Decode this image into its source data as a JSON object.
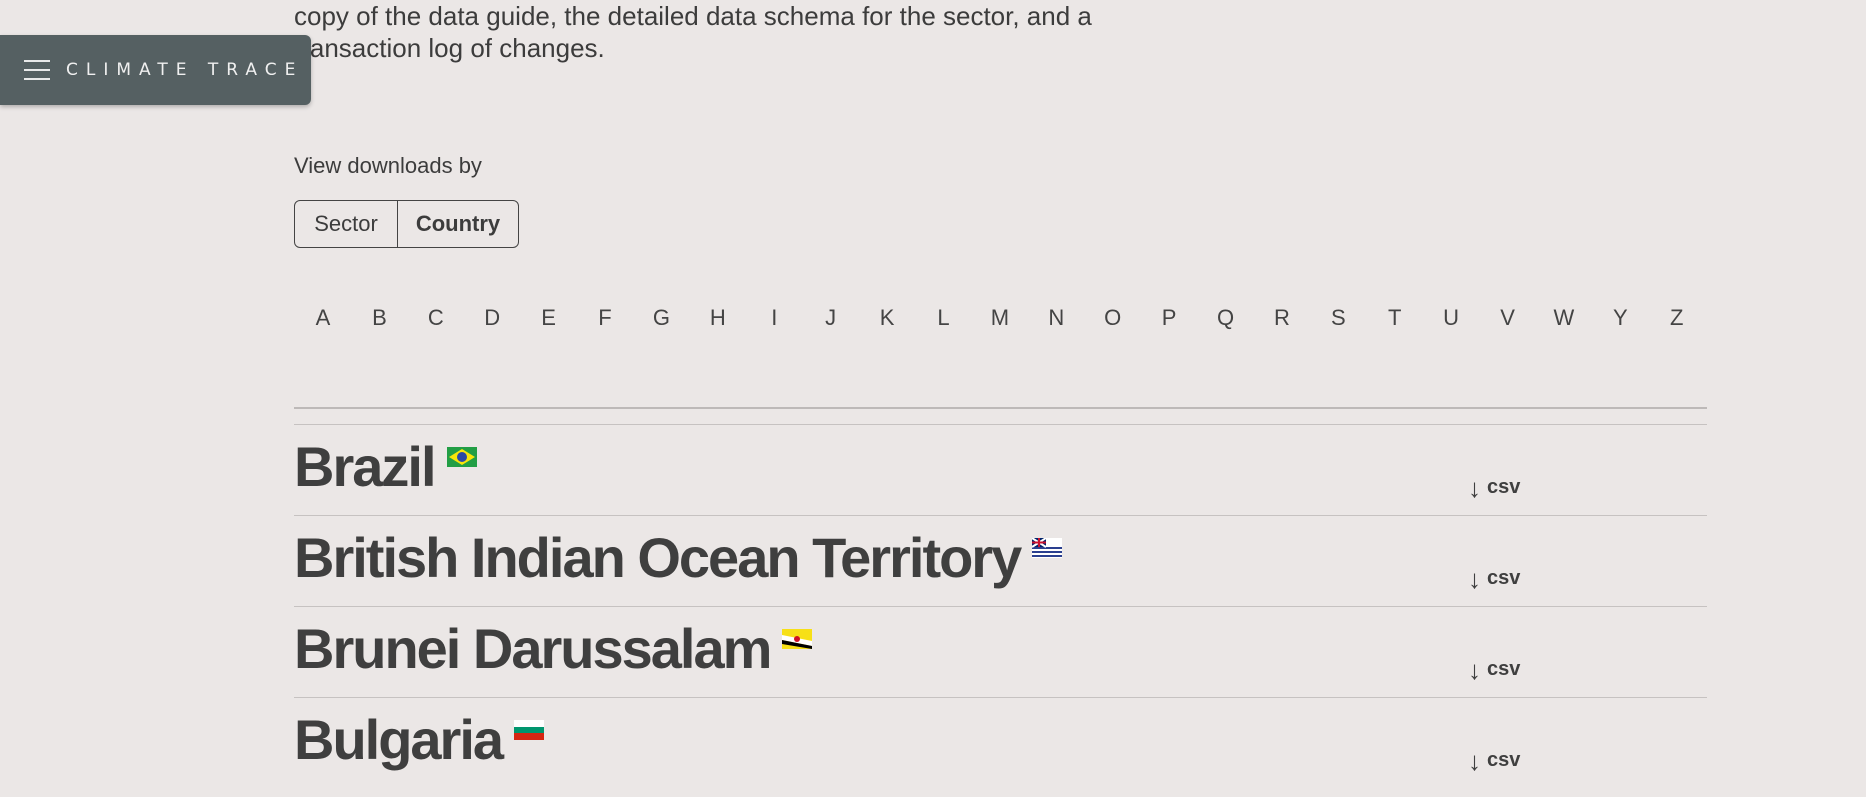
{
  "intro": {
    "line1": "copy of the data guide, the detailed data schema for the sector, and a",
    "line2": "transaction log of changes."
  },
  "nav": {
    "logo": "CLIMATE TRACE"
  },
  "view": {
    "label": "View downloads by",
    "options": [
      "Sector",
      "Country"
    ],
    "selected": "Country"
  },
  "alphabet": [
    "A",
    "B",
    "C",
    "D",
    "E",
    "F",
    "G",
    "H",
    "I",
    "J",
    "K",
    "L",
    "M",
    "N",
    "O",
    "P",
    "Q",
    "R",
    "S",
    "T",
    "U",
    "V",
    "W",
    "Y",
    "Z"
  ],
  "countries": [
    {
      "name": "Brazil",
      "download": "csv"
    },
    {
      "name": "British Indian Ocean Territory",
      "download": "csv"
    },
    {
      "name": "Brunei Darussalam",
      "download": "csv"
    },
    {
      "name": "Bulgaria",
      "download": "csv"
    }
  ]
}
